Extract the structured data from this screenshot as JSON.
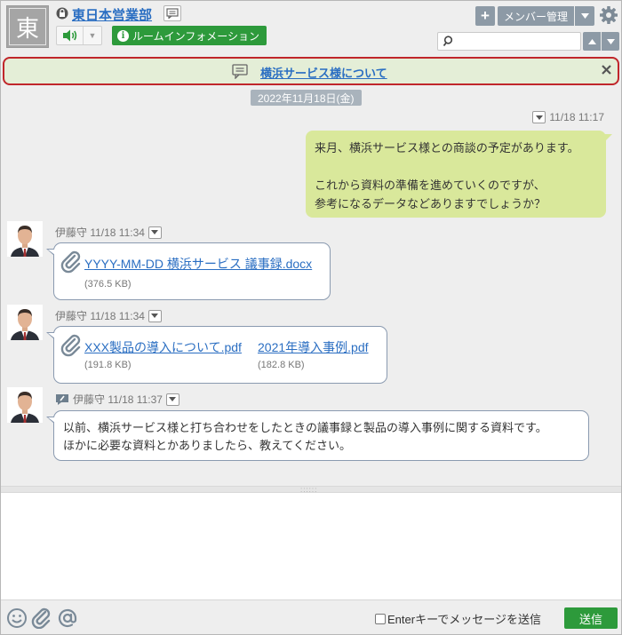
{
  "header": {
    "room_avatar_char": "東",
    "room_name": "東日本営業部",
    "info_button_label": "ルームインフォメーション",
    "member_button_label": "メンバー管理",
    "search_placeholder": ""
  },
  "topic": {
    "text": "横浜サービス様について"
  },
  "messages": {
    "date_label": "2022年11月18日(金)",
    "self_message": {
      "time": "11/18 11:17",
      "lines": [
        "来月、横浜サービス様との商談の予定があります。",
        "",
        "これから資料の準備を進めていくのですが、",
        "参考になるデータなどありますでしょうか？"
      ]
    },
    "msg1": {
      "sender_time": "伊藤守 11/18 11:34",
      "file_name": "YYYY-MM-DD 横浜サービス 議事録.docx",
      "file_size": "(376.5 KB)"
    },
    "msg2": {
      "sender_time": "伊藤守 11/18 11:34",
      "file1_name": "XXX製品の導入について.pdf",
      "file1_size": "(191.8 KB)",
      "file2_name": "2021年導入事例.pdf",
      "file2_size": "(182.8 KB)"
    },
    "msg3": {
      "sender_time": "伊藤守 11/18 11:37",
      "line1": "以前、横浜サービス様と打ち合わせをしたときの議事録と製品の導入事例に関する資料です。",
      "line2": "ほかに必要な資料とかありましたら、教えてください。"
    }
  },
  "composer": {
    "value": "",
    "enter_option_label": "Enterキーでメッセージを送信",
    "send_label": "送信"
  },
  "colors": {
    "accent_green": "#2d9a3b",
    "link_blue": "#2a6ec2",
    "topic_border": "#c0262b",
    "self_bubble": "#d9e89b"
  }
}
